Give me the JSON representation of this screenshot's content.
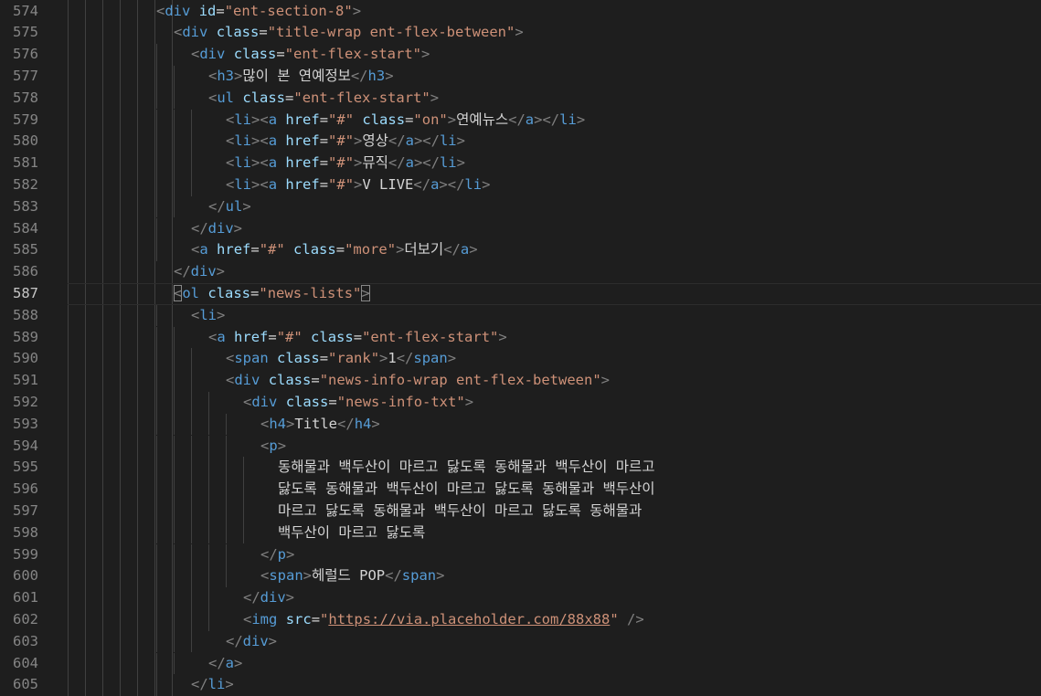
{
  "editor": {
    "active_line": 587,
    "lines": [
      {
        "n": 574,
        "indent": 6,
        "tokens": [
          [
            "br",
            "<"
          ],
          [
            "tag",
            "div"
          ],
          [
            "t",
            " "
          ],
          [
            "attr",
            "id"
          ],
          [
            "eq",
            "="
          ],
          [
            "str",
            "\"ent-section-8\""
          ],
          [
            "br",
            ">"
          ]
        ]
      },
      {
        "n": 575,
        "indent": 7,
        "tokens": [
          [
            "br",
            "<"
          ],
          [
            "tag",
            "div"
          ],
          [
            "t",
            " "
          ],
          [
            "attr",
            "class"
          ],
          [
            "eq",
            "="
          ],
          [
            "str",
            "\"title-wrap ent-flex-between\""
          ],
          [
            "br",
            ">"
          ]
        ]
      },
      {
        "n": 576,
        "indent": 8,
        "tokens": [
          [
            "br",
            "<"
          ],
          [
            "tag",
            "div"
          ],
          [
            "t",
            " "
          ],
          [
            "attr",
            "class"
          ],
          [
            "eq",
            "="
          ],
          [
            "str",
            "\"ent-flex-start\""
          ],
          [
            "br",
            ">"
          ]
        ]
      },
      {
        "n": 577,
        "indent": 9,
        "tokens": [
          [
            "br",
            "<"
          ],
          [
            "tag",
            "h3"
          ],
          [
            "br",
            ">"
          ],
          [
            "t",
            "많이 본 연예정보"
          ],
          [
            "br",
            "</"
          ],
          [
            "tag",
            "h3"
          ],
          [
            "br",
            ">"
          ]
        ]
      },
      {
        "n": 578,
        "indent": 9,
        "tokens": [
          [
            "br",
            "<"
          ],
          [
            "tag",
            "ul"
          ],
          [
            "t",
            " "
          ],
          [
            "attr",
            "class"
          ],
          [
            "eq",
            "="
          ],
          [
            "str",
            "\"ent-flex-start\""
          ],
          [
            "br",
            ">"
          ]
        ]
      },
      {
        "n": 579,
        "indent": 10,
        "tokens": [
          [
            "br",
            "<"
          ],
          [
            "tag",
            "li"
          ],
          [
            "br",
            "><"
          ],
          [
            "tag",
            "a"
          ],
          [
            "t",
            " "
          ],
          [
            "attr",
            "href"
          ],
          [
            "eq",
            "="
          ],
          [
            "str",
            "\"#\""
          ],
          [
            "t",
            " "
          ],
          [
            "attr",
            "class"
          ],
          [
            "eq",
            "="
          ],
          [
            "str",
            "\"on\""
          ],
          [
            "br",
            ">"
          ],
          [
            "t",
            "연예뉴스"
          ],
          [
            "br",
            "</"
          ],
          [
            "tag",
            "a"
          ],
          [
            "br",
            "></"
          ],
          [
            "tag",
            "li"
          ],
          [
            "br",
            ">"
          ]
        ]
      },
      {
        "n": 580,
        "indent": 10,
        "tokens": [
          [
            "br",
            "<"
          ],
          [
            "tag",
            "li"
          ],
          [
            "br",
            "><"
          ],
          [
            "tag",
            "a"
          ],
          [
            "t",
            " "
          ],
          [
            "attr",
            "href"
          ],
          [
            "eq",
            "="
          ],
          [
            "str",
            "\"#\""
          ],
          [
            "br",
            ">"
          ],
          [
            "t",
            "영상"
          ],
          [
            "br",
            "</"
          ],
          [
            "tag",
            "a"
          ],
          [
            "br",
            "></"
          ],
          [
            "tag",
            "li"
          ],
          [
            "br",
            ">"
          ]
        ]
      },
      {
        "n": 581,
        "indent": 10,
        "tokens": [
          [
            "br",
            "<"
          ],
          [
            "tag",
            "li"
          ],
          [
            "br",
            "><"
          ],
          [
            "tag",
            "a"
          ],
          [
            "t",
            " "
          ],
          [
            "attr",
            "href"
          ],
          [
            "eq",
            "="
          ],
          [
            "str",
            "\"#\""
          ],
          [
            "br",
            ">"
          ],
          [
            "t",
            "뮤직"
          ],
          [
            "br",
            "</"
          ],
          [
            "tag",
            "a"
          ],
          [
            "br",
            "></"
          ],
          [
            "tag",
            "li"
          ],
          [
            "br",
            ">"
          ]
        ]
      },
      {
        "n": 582,
        "indent": 10,
        "tokens": [
          [
            "br",
            "<"
          ],
          [
            "tag",
            "li"
          ],
          [
            "br",
            "><"
          ],
          [
            "tag",
            "a"
          ],
          [
            "t",
            " "
          ],
          [
            "attr",
            "href"
          ],
          [
            "eq",
            "="
          ],
          [
            "str",
            "\"#\""
          ],
          [
            "br",
            ">"
          ],
          [
            "t",
            "V LIVE"
          ],
          [
            "br",
            "</"
          ],
          [
            "tag",
            "a"
          ],
          [
            "br",
            "></"
          ],
          [
            "tag",
            "li"
          ],
          [
            "br",
            ">"
          ]
        ]
      },
      {
        "n": 583,
        "indent": 9,
        "tokens": [
          [
            "br",
            "</"
          ],
          [
            "tag",
            "ul"
          ],
          [
            "br",
            ">"
          ]
        ]
      },
      {
        "n": 584,
        "indent": 8,
        "tokens": [
          [
            "br",
            "</"
          ],
          [
            "tag",
            "div"
          ],
          [
            "br",
            ">"
          ]
        ]
      },
      {
        "n": 585,
        "indent": 8,
        "tokens": [
          [
            "br",
            "<"
          ],
          [
            "tag",
            "a"
          ],
          [
            "t",
            " "
          ],
          [
            "attr",
            "href"
          ],
          [
            "eq",
            "="
          ],
          [
            "str",
            "\"#\""
          ],
          [
            "t",
            " "
          ],
          [
            "attr",
            "class"
          ],
          [
            "eq",
            "="
          ],
          [
            "str",
            "\"more\""
          ],
          [
            "br",
            ">"
          ],
          [
            "t",
            "더보기"
          ],
          [
            "br",
            "</"
          ],
          [
            "tag",
            "a"
          ],
          [
            "br",
            ">"
          ]
        ]
      },
      {
        "n": 586,
        "indent": 7,
        "tokens": [
          [
            "br",
            "</"
          ],
          [
            "tag",
            "div"
          ],
          [
            "br",
            ">"
          ]
        ]
      },
      {
        "n": 587,
        "indent": 7,
        "tokens": [
          [
            "brm",
            "<"
          ],
          [
            "tag",
            "ol"
          ],
          [
            "t",
            " "
          ],
          [
            "attr",
            "class"
          ],
          [
            "eq",
            "="
          ],
          [
            "str",
            "\"news-lists\""
          ],
          [
            "brm",
            ">"
          ]
        ]
      },
      {
        "n": 588,
        "indent": 8,
        "tokens": [
          [
            "br",
            "<"
          ],
          [
            "tag",
            "li"
          ],
          [
            "br",
            ">"
          ]
        ]
      },
      {
        "n": 589,
        "indent": 9,
        "tokens": [
          [
            "br",
            "<"
          ],
          [
            "tag",
            "a"
          ],
          [
            "t",
            " "
          ],
          [
            "attr",
            "href"
          ],
          [
            "eq",
            "="
          ],
          [
            "str",
            "\"#\""
          ],
          [
            "t",
            " "
          ],
          [
            "attr",
            "class"
          ],
          [
            "eq",
            "="
          ],
          [
            "str",
            "\"ent-flex-start\""
          ],
          [
            "br",
            ">"
          ]
        ]
      },
      {
        "n": 590,
        "indent": 10,
        "tokens": [
          [
            "br",
            "<"
          ],
          [
            "tag",
            "span"
          ],
          [
            "t",
            " "
          ],
          [
            "attr",
            "class"
          ],
          [
            "eq",
            "="
          ],
          [
            "str",
            "\"rank\""
          ],
          [
            "br",
            ">"
          ],
          [
            "t",
            "1"
          ],
          [
            "br",
            "</"
          ],
          [
            "tag",
            "span"
          ],
          [
            "br",
            ">"
          ]
        ]
      },
      {
        "n": 591,
        "indent": 10,
        "tokens": [
          [
            "br",
            "<"
          ],
          [
            "tag",
            "div"
          ],
          [
            "t",
            " "
          ],
          [
            "attr",
            "class"
          ],
          [
            "eq",
            "="
          ],
          [
            "str",
            "\"news-info-wrap ent-flex-between\""
          ],
          [
            "br",
            ">"
          ]
        ]
      },
      {
        "n": 592,
        "indent": 11,
        "tokens": [
          [
            "br",
            "<"
          ],
          [
            "tag",
            "div"
          ],
          [
            "t",
            " "
          ],
          [
            "attr",
            "class"
          ],
          [
            "eq",
            "="
          ],
          [
            "str",
            "\"news-info-txt\""
          ],
          [
            "br",
            ">"
          ]
        ]
      },
      {
        "n": 593,
        "indent": 12,
        "tokens": [
          [
            "br",
            "<"
          ],
          [
            "tag",
            "h4"
          ],
          [
            "br",
            ">"
          ],
          [
            "t",
            "Title"
          ],
          [
            "br",
            "</"
          ],
          [
            "tag",
            "h4"
          ],
          [
            "br",
            ">"
          ]
        ]
      },
      {
        "n": 594,
        "indent": 12,
        "tokens": [
          [
            "br",
            "<"
          ],
          [
            "tag",
            "p"
          ],
          [
            "br",
            ">"
          ]
        ]
      },
      {
        "n": 595,
        "indent": 13,
        "tokens": [
          [
            "t",
            "동해물과 백두산이 마르고 닳도록 동해물과 백두산이 마르고"
          ]
        ]
      },
      {
        "n": 596,
        "indent": 13,
        "tokens": [
          [
            "t",
            "닳도록 동해물과 백두산이 마르고 닳도록 동해물과 백두산이"
          ]
        ]
      },
      {
        "n": 597,
        "indent": 13,
        "tokens": [
          [
            "t",
            "마르고 닳도록 동해물과 백두산이 마르고 닳도록 동해물과"
          ]
        ]
      },
      {
        "n": 598,
        "indent": 13,
        "tokens": [
          [
            "t",
            "백두산이 마르고 닳도록"
          ]
        ]
      },
      {
        "n": 599,
        "indent": 12,
        "tokens": [
          [
            "br",
            "</"
          ],
          [
            "tag",
            "p"
          ],
          [
            "br",
            ">"
          ]
        ]
      },
      {
        "n": 600,
        "indent": 12,
        "tokens": [
          [
            "br",
            "<"
          ],
          [
            "tag",
            "span"
          ],
          [
            "br",
            ">"
          ],
          [
            "t",
            "헤럴드 POP"
          ],
          [
            "br",
            "</"
          ],
          [
            "tag",
            "span"
          ],
          [
            "br",
            ">"
          ]
        ]
      },
      {
        "n": 601,
        "indent": 11,
        "tokens": [
          [
            "br",
            "</"
          ],
          [
            "tag",
            "div"
          ],
          [
            "br",
            ">"
          ]
        ]
      },
      {
        "n": 602,
        "indent": 11,
        "tokens": [
          [
            "br",
            "<"
          ],
          [
            "tag",
            "img"
          ],
          [
            "t",
            " "
          ],
          [
            "attr",
            "src"
          ],
          [
            "eq",
            "="
          ],
          [
            "str",
            "\""
          ],
          [
            "url",
            "https://via.placeholder.com/88x88"
          ],
          [
            "str",
            "\""
          ],
          [
            "t",
            " "
          ],
          [
            "br",
            "/>"
          ]
        ]
      },
      {
        "n": 603,
        "indent": 10,
        "tokens": [
          [
            "br",
            "</"
          ],
          [
            "tag",
            "div"
          ],
          [
            "br",
            ">"
          ]
        ]
      },
      {
        "n": 604,
        "indent": 9,
        "tokens": [
          [
            "br",
            "</"
          ],
          [
            "tag",
            "a"
          ],
          [
            "br",
            ">"
          ]
        ]
      },
      {
        "n": 605,
        "indent": 8,
        "tokens": [
          [
            "br",
            "</"
          ],
          [
            "tag",
            "li"
          ],
          [
            "br",
            ">"
          ]
        ]
      }
    ]
  }
}
